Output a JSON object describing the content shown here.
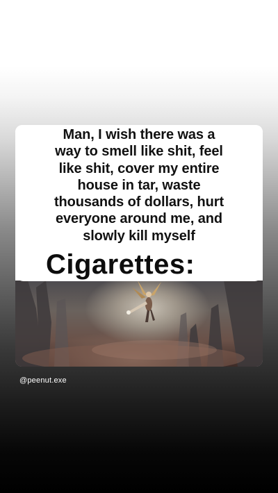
{
  "post": {
    "caption_lines": [
      "Man, I wish there was a",
      "way to smell like shit, feel",
      "like shit, cover my entire",
      "house in tar, waste",
      "thousands of dollars, hurt",
      "everyone around me, and",
      "slowly kill myself"
    ],
    "punchline": "Cigarettes:",
    "image_description_icon": "flying-winged-hero-illustration"
  },
  "story": {
    "handle": "@peenut.exe"
  }
}
